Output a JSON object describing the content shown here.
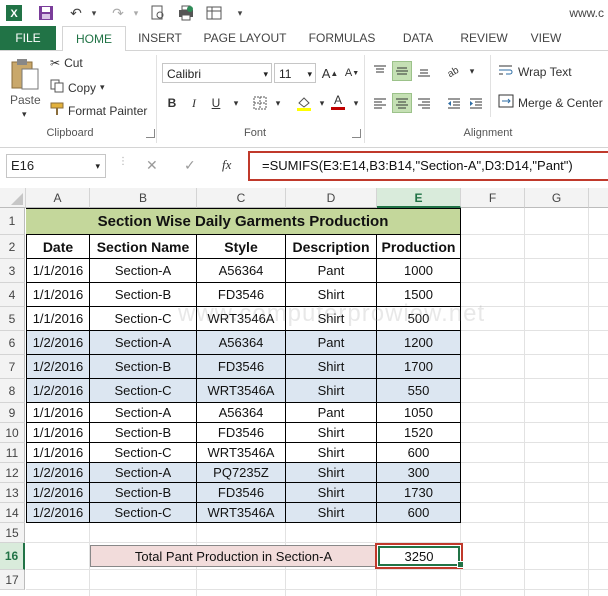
{
  "quick_access": {
    "title_fragment": "www.c"
  },
  "tabs": [
    "FILE",
    "HOME",
    "INSERT",
    "PAGE LAYOUT",
    "FORMULAS",
    "DATA",
    "REVIEW",
    "VIEW"
  ],
  "ribbon": {
    "clipboard": {
      "paste": "Paste",
      "cut": "Cut",
      "copy": "Copy",
      "format_painter": "Format Painter",
      "label": "Clipboard"
    },
    "font": {
      "font_name": "Calibri",
      "font_size": "11",
      "bold": "B",
      "italic": "I",
      "underline": "U",
      "font_color_letter": "A",
      "label": "Font"
    },
    "alignment": {
      "wrap_text": "Wrap Text",
      "merge_center": "Merge & Center",
      "label": "Alignment"
    }
  },
  "formula_bar": {
    "name_box": "E16",
    "cancel": "✕",
    "enter": "✓",
    "fx": "fx",
    "formula": "=SUMIFS(E3:E14,B3:B14,\"Section-A\",D3:D14,\"Pant\")"
  },
  "columns": [
    "A",
    "B",
    "C",
    "D",
    "E",
    "F",
    "G"
  ],
  "rows": [
    "1",
    "2",
    "3",
    "4",
    "5",
    "6",
    "7",
    "8",
    "9",
    "10",
    "11",
    "12",
    "13",
    "14",
    "15",
    "16",
    "17"
  ],
  "sheet": {
    "title": "Section Wise Daily Garments Production",
    "headers": [
      "Date",
      "Section Name",
      "Style",
      "Description",
      "Production"
    ],
    "data": [
      [
        "1/1/2016",
        "Section-A",
        "A56364",
        "Pant",
        "1000"
      ],
      [
        "1/1/2016",
        "Section-B",
        "FD3546",
        "Shirt",
        "1500"
      ],
      [
        "1/1/2016",
        "Section-C",
        "WRT3546A",
        "Shirt",
        "500"
      ],
      [
        "1/2/2016",
        "Section-A",
        "A56364",
        "Pant",
        "1200"
      ],
      [
        "1/2/2016",
        "Section-B",
        "FD3546",
        "Shirt",
        "1700"
      ],
      [
        "1/2/2016",
        "Section-C",
        "WRT3546A",
        "Shirt",
        "550"
      ],
      [
        "1/1/2016",
        "Section-A",
        "A56364",
        "Pant",
        "1050"
      ],
      [
        "1/1/2016",
        "Section-B",
        "FD3546",
        "Shirt",
        "1520"
      ],
      [
        "1/1/2016",
        "Section-C",
        "WRT3546A",
        "Shirt",
        "600"
      ],
      [
        "1/2/2016",
        "Section-A",
        "PQ7235Z",
        "Shirt",
        "300"
      ],
      [
        "1/2/2016",
        "Section-B",
        "FD3546",
        "Shirt",
        "1730"
      ],
      [
        "1/2/2016",
        "Section-C",
        "WRT3546A",
        "Shirt",
        "600"
      ]
    ],
    "total_label": "Total Pant Production in Section-A",
    "total_value": "3250",
    "watermark": "www.computerprowiew.net"
  },
  "colors": {
    "accent": "#217346",
    "title_fill": "#c4d79b",
    "blue_fill": "#dce6f1",
    "pink_fill": "#f2dcdb",
    "highlight_border": "#c0392b"
  }
}
